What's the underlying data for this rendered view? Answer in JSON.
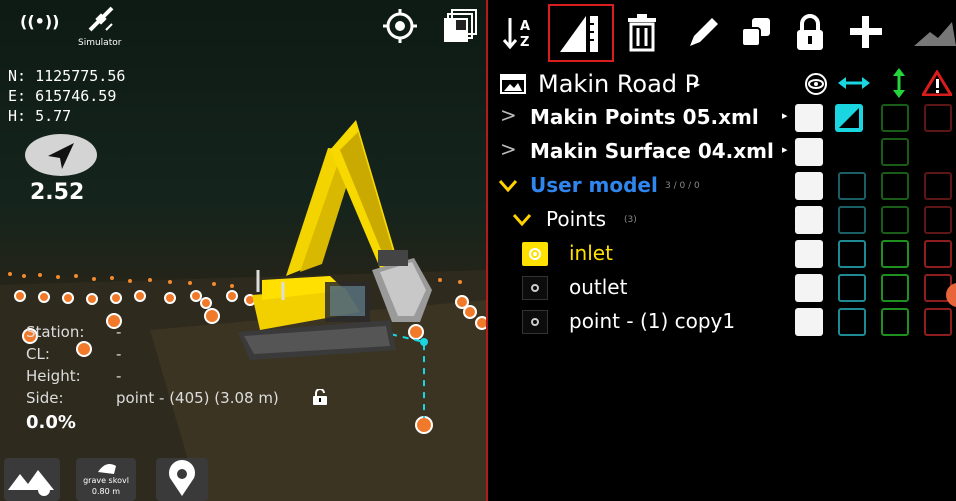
{
  "status": {
    "simulator_label": "Simulator"
  },
  "position": {
    "north": "N: 1125775.56",
    "east": "E: 615746.59",
    "height": "H: 5.77"
  },
  "speed": "2.52",
  "info": {
    "station_label": "Station:",
    "station_value": "-",
    "cl_label": "CL:",
    "cl_value": "-",
    "height_label": "Height:",
    "height_value": "-",
    "side_label": "Side:",
    "side_value": "point - (405) (3.08 m)"
  },
  "grade_percent": "0.0%",
  "bottom_tools": {
    "bucket_name": "grave skovl",
    "bucket_width": "0.80 m"
  },
  "colors": {
    "accent_red": "#d91c1c",
    "cyan": "#19d6e0",
    "green": "#24d63a",
    "yellow_highlight": "#ffe100",
    "link_blue": "#2f86ee"
  },
  "toolbar_icons": [
    "sort-az-icon",
    "ruler-icon",
    "trash-icon",
    "pencil-icon",
    "copy-icon",
    "lock-icon",
    "plus-icon",
    "terrain-icon"
  ],
  "tree": {
    "header_title": "Makin Road P",
    "header_icons": [
      "eye-icon",
      "horizontal-arrows-icon",
      "vertical-arrows-icon",
      "warning-icon"
    ],
    "rows": [
      {
        "label": "Makin Points 05.xml",
        "level": 0
      },
      {
        "label": "Makin Surface 04.xml",
        "level": 0
      },
      {
        "label": "User model",
        "counts": "3 / 0 / 0",
        "level": 0
      },
      {
        "label": "Points",
        "counts": "(3)",
        "level": 1
      },
      {
        "label": "inlet",
        "level": 2
      },
      {
        "label": "outlet",
        "level": 2
      },
      {
        "label": "point - (1) copy1",
        "level": 2
      }
    ]
  }
}
